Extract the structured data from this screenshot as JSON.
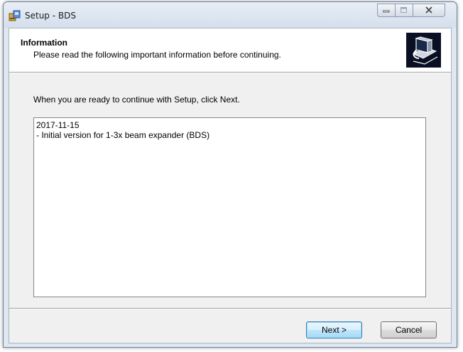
{
  "window": {
    "title": "Setup - BDS",
    "app_icon": "setup-package-icon",
    "caption_buttons": [
      "minimize-icon",
      "maximize-icon",
      "close-icon"
    ]
  },
  "header": {
    "title": "Information",
    "subtitle": "Please read the following important information before continuing.",
    "image": "setup-computer-icon"
  },
  "body": {
    "instruction": "When you are ready to continue with Setup, click Next.",
    "info_lines": [
      "2017-11-15",
      "- Initial version for 1-3x beam expander (BDS)"
    ]
  },
  "footer": {
    "next_label": "Next >",
    "cancel_label": "Cancel"
  },
  "colors": {
    "frame": "#dfe7f1",
    "client": "#f0f0f0",
    "header": "#ffffff",
    "default_button_border": "#3c7fb1"
  }
}
